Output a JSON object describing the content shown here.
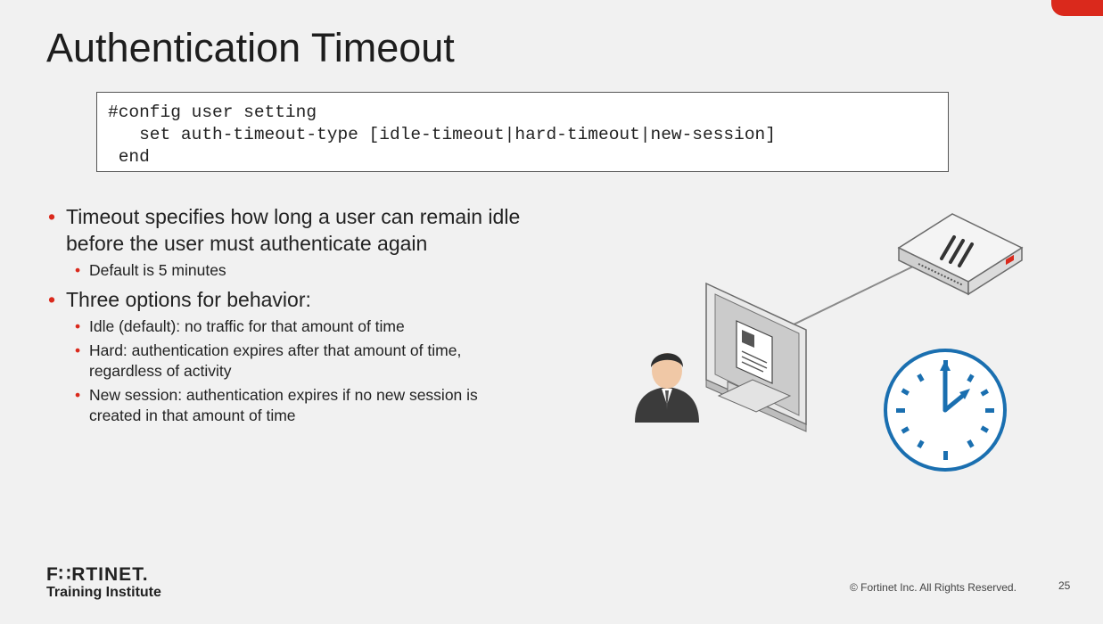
{
  "slide": {
    "title": "Authentication Timeout",
    "code_lines": [
      "#config user setting",
      "   set auth-timeout-type [idle-timeout|hard-timeout|new-session]",
      " end"
    ],
    "bullets": [
      {
        "text": "Timeout specifies how long a user can remain idle before the user must authenticate again",
        "sub": [
          "Default is 5 minutes"
        ]
      },
      {
        "text": "Three options for behavior:",
        "sub": [
          "Idle (default): no traffic for that amount of time",
          "Hard: authentication expires after that amount of time, regardless of activity",
          "New session: authentication expires if no new session is created in that amount of time"
        ]
      }
    ]
  },
  "footer": {
    "logo_text": "F∷RTINET.",
    "logo_subtitle": "Training Institute",
    "copyright": "© Fortinet Inc. All Rights Reserved.",
    "page_number": "25"
  },
  "colors": {
    "accent": "#da291c",
    "clock_blue": "#1a6fb0",
    "background": "#f1f1f1"
  },
  "icons": [
    "user-avatar-icon",
    "monitor-icon",
    "firewall-device-icon",
    "clock-icon"
  ]
}
